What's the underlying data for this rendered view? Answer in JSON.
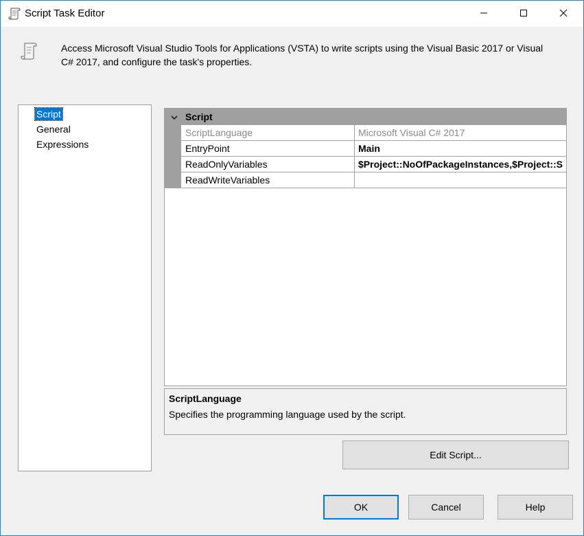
{
  "window": {
    "title": "Script Task Editor",
    "icon": "script-scroll-icon",
    "controls": [
      "minimize-icon",
      "maximize-icon",
      "close-icon"
    ]
  },
  "description": {
    "icon": "script-scroll-icon",
    "text": "Access Microsoft Visual Studio Tools for Applications (VSTA) to write scripts using the Visual Basic 2017 or Visual C# 2017, and configure the task's properties."
  },
  "nav": {
    "items": [
      {
        "label": "Script",
        "selected": true
      },
      {
        "label": "General",
        "selected": false
      },
      {
        "label": "Expressions",
        "selected": false
      }
    ]
  },
  "property_grid": {
    "category": {
      "label": "Script",
      "icon": "chevron-down-icon"
    },
    "rows": [
      {
        "name": "ScriptLanguage",
        "value": "Microsoft Visual C# 2017",
        "readonly": true
      },
      {
        "name": "EntryPoint",
        "value": "Main",
        "bold": true
      },
      {
        "name": "ReadOnlyVariables",
        "value": "$Project::NoOfPackageInstances,$Project::S",
        "bold": true
      },
      {
        "name": "ReadWriteVariables",
        "value": ""
      }
    ]
  },
  "help_pane": {
    "title": "ScriptLanguage",
    "description": "Specifies the programming language used by the script."
  },
  "buttons": {
    "edit_script": "Edit Script...",
    "ok": "OK",
    "cancel": "Cancel",
    "help": "Help"
  },
  "colors": {
    "selection": "#0078d7",
    "category_bg": "#a0a0a0",
    "window_bg": "#f0f0f0",
    "border_accent": "#1883d7"
  }
}
